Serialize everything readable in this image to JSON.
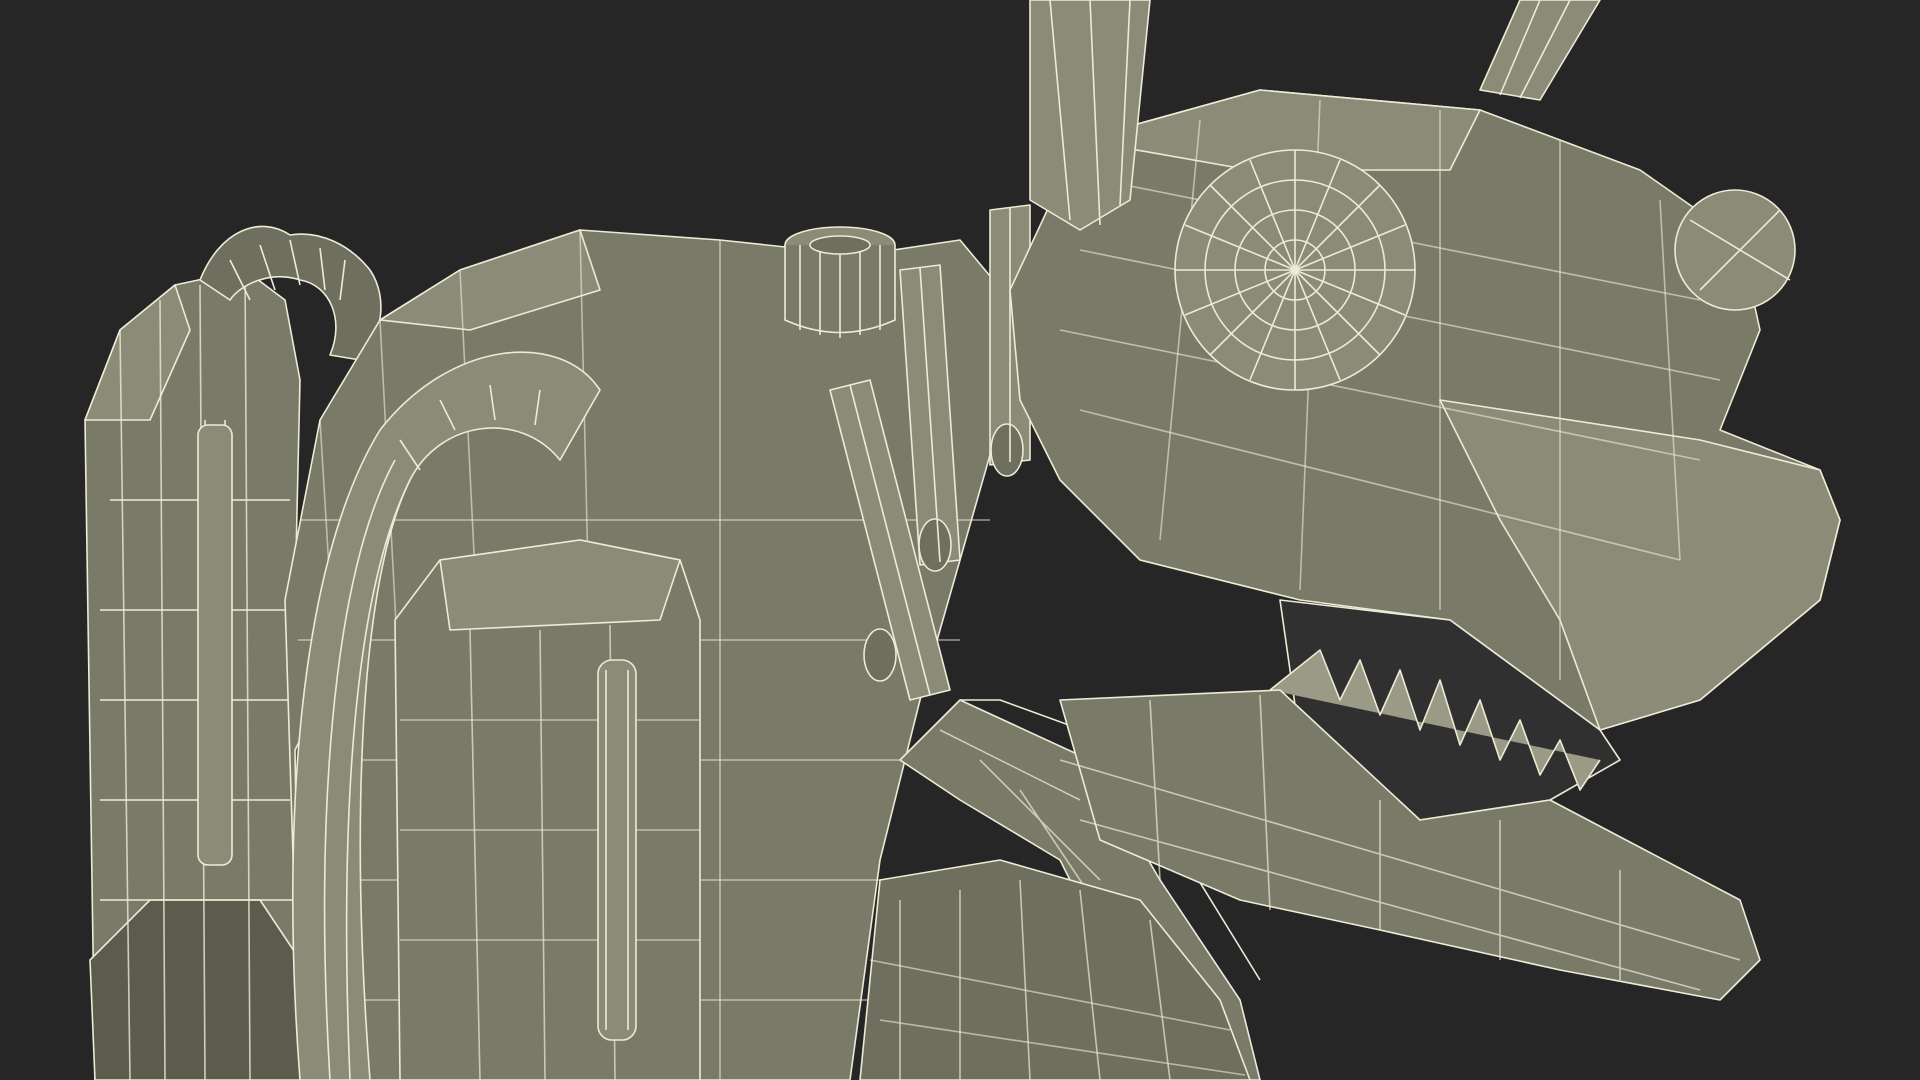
{
  "scene": {
    "background_color": "#262626",
    "mesh_fill_color": "#7a7a69",
    "mesh_shadow_color": "#5c5c4e",
    "mesh_highlight_color": "#8b8b78",
    "wireframe_color": "#ecebd6"
  }
}
